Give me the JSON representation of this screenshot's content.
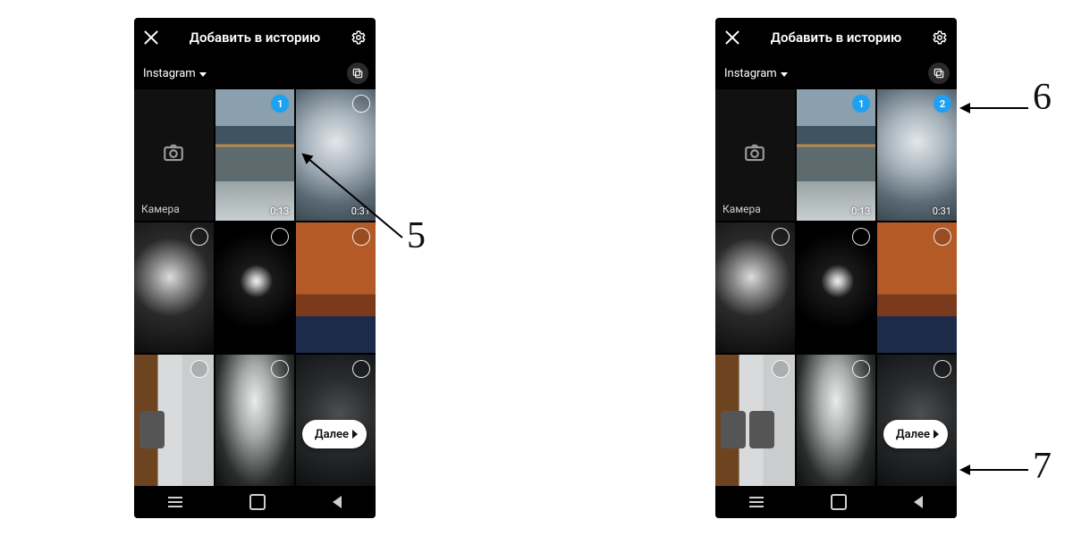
{
  "header": {
    "title": "Добавить в историю"
  },
  "source": {
    "label": "Instagram"
  },
  "camera": {
    "label": "Камера"
  },
  "next": {
    "label": "Далее"
  },
  "left": {
    "cells": [
      {
        "type": "camera"
      },
      {
        "type": "video",
        "selected": true,
        "badge": "1",
        "duration": "0:13",
        "scene": "scene-beach"
      },
      {
        "type": "video",
        "selected": false,
        "duration": "0:31",
        "scene": "scene-waves"
      },
      {
        "type": "photo",
        "selected": false,
        "scene": "scene-skull"
      },
      {
        "type": "photo",
        "selected": false,
        "scene": "scene-darkface"
      },
      {
        "type": "photo",
        "selected": false,
        "scene": "scene-desk"
      },
      {
        "type": "photo",
        "selected": false,
        "scene": "scene-cat"
      },
      {
        "type": "photo",
        "selected": false,
        "scene": "scene-light"
      },
      {
        "type": "photo",
        "selected": false,
        "scene": "scene-darkrock"
      }
    ],
    "previews": [
      "scene-beach"
    ]
  },
  "right": {
    "cells": [
      {
        "type": "camera"
      },
      {
        "type": "video",
        "selected": true,
        "badge": "1",
        "duration": "0:13",
        "scene": "scene-beach"
      },
      {
        "type": "video",
        "selected": true,
        "badge": "2",
        "duration": "0:31",
        "scene": "scene-waves"
      },
      {
        "type": "photo",
        "selected": false,
        "scene": "scene-skull"
      },
      {
        "type": "photo",
        "selected": false,
        "scene": "scene-darkface"
      },
      {
        "type": "photo",
        "selected": false,
        "scene": "scene-desk"
      },
      {
        "type": "photo",
        "selected": false,
        "scene": "scene-cat"
      },
      {
        "type": "photo",
        "selected": false,
        "scene": "scene-light"
      },
      {
        "type": "photo",
        "selected": false,
        "scene": "scene-darkrock"
      }
    ],
    "previews": [
      "scene-beach",
      "scene-waves"
    ]
  },
  "annotations": {
    "a5": "5",
    "a6": "6",
    "a7": "7"
  }
}
